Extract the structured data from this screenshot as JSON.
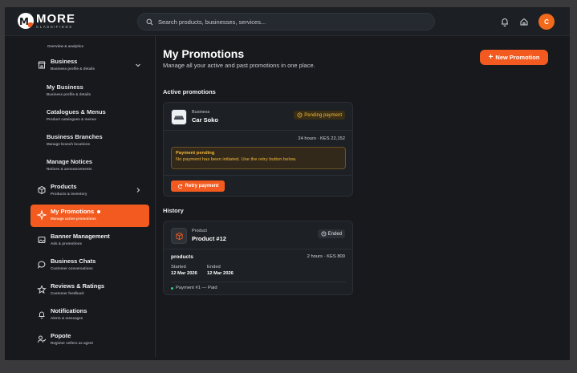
{
  "header": {
    "brand": "MORE",
    "brand_sub": "CLASSIFIEDS",
    "search_placeholder": "Search products, businesses, services...",
    "avatar_initial": "C"
  },
  "sidebar": {
    "overview_sub": "Overview & analytics",
    "items": {
      "business": {
        "label": "Business",
        "sub": "Business profile & details"
      },
      "my_business": {
        "label": "My Business",
        "sub": "Business profile & details"
      },
      "catalogues": {
        "label": "Catalogues & Menus",
        "sub": "Product catalogues & menus"
      },
      "branches": {
        "label": "Business Branches",
        "sub": "Manage branch locations"
      },
      "notices": {
        "label": "Manage Notices",
        "sub": "Notices & announcements"
      },
      "products": {
        "label": "Products",
        "sub": "Products & inventory"
      },
      "promotions": {
        "label": "My Promotions",
        "sub": "Manage active promotions"
      },
      "banners": {
        "label": "Banner Management",
        "sub": "Ads & promotions"
      },
      "chats": {
        "label": "Business Chats",
        "sub": "Customer conversations"
      },
      "reviews": {
        "label": "Reviews & Ratings",
        "sub": "Customer feedback"
      },
      "notifications": {
        "label": "Notifications",
        "sub": "Alerts & messages"
      },
      "popote": {
        "label": "Popote",
        "sub": "Register sellers as agent"
      }
    }
  },
  "main": {
    "title": "My Promotions",
    "subtitle": "Manage all your active and past promotions in one place.",
    "new_button": "New Promotion",
    "active_label": "Active promotions",
    "history_label": "History",
    "active_card": {
      "kind": "Business",
      "name": "Car Soko",
      "status": "Pending payment",
      "meta": "24 hours · KES 22,152",
      "alert_title": "Payment pending",
      "alert_body": "No payment has been initiated. Use the retry button below.",
      "retry_label": "Retry payment"
    },
    "history_card": {
      "kind": "Product",
      "name": "Product #12",
      "status": "Ended",
      "category": "products",
      "meta": "2 hours · KES 800",
      "started_label": "Started",
      "started_value": "12 Mar 2026",
      "ended_label": "Ended",
      "ended_value": "12 Mar 2026",
      "payment": "Payment #1 — Paid"
    }
  },
  "colors": {
    "accent": "#f25a1f",
    "pending": "#f0b73a",
    "paid": "#2fcf7c"
  }
}
